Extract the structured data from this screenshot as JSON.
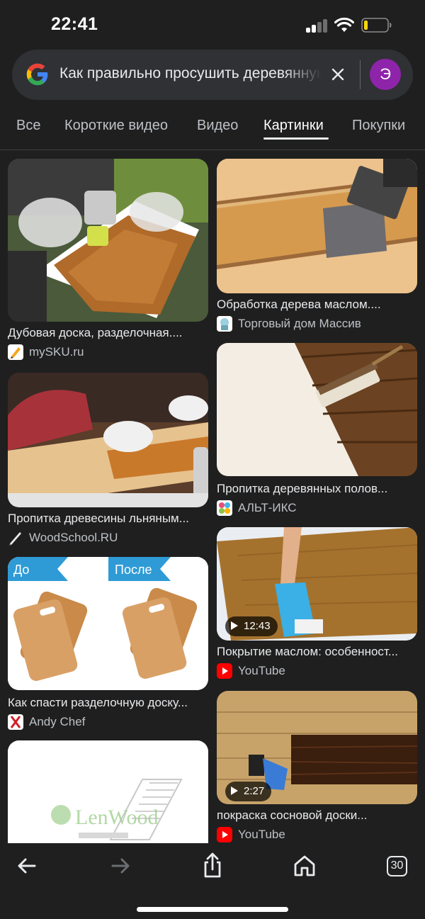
{
  "status": {
    "time": "22:41"
  },
  "search": {
    "query": "Как правильно просушить деревянную доску после пропитки маслом",
    "avatar_letter": "Э"
  },
  "tabs": [
    {
      "label": "Все"
    },
    {
      "label": "Короткие видео"
    },
    {
      "label": "Видео"
    },
    {
      "label": "Картинки",
      "active": true
    },
    {
      "label": "Покупки"
    }
  ],
  "results": [
    {
      "caption": "Дубовая доска, разделочная....",
      "source": "mySKU.ru",
      "icon": "mysku-favicon",
      "image": "gloved-hands-oiling-oak-cutting-board"
    },
    {
      "caption": "Обработка дерева маслом....",
      "source": "Торговый дом Массив",
      "icon": "massiv-favicon",
      "image": "brush-applying-oil-to-pine-board"
    },
    {
      "caption": "Пропитка древесины льняным...",
      "source": "WoodSchool.RU",
      "icon": "woodschool-favicon",
      "image": "hand-wiping-oil-on-pine-plank"
    },
    {
      "caption": "Пропитка деревянных полов...",
      "source": "АЛЬТ-ИКС",
      "icon": "alt-iks-favicon",
      "image": "applicator-staining-dark-floor"
    },
    {
      "caption": "Как спасти разделочную доску...",
      "source": "Andy Chef",
      "icon": "andy-chef-favicon",
      "image": "cutting-boards-before-after",
      "labels": [
        "До",
        "После"
      ]
    },
    {
      "caption": "Покрытие маслом: особенност...",
      "source": "YouTube",
      "icon": "youtube-favicon",
      "image": "blue-glove-oiling-wood-panel",
      "duration": "12:43"
    },
    {
      "caption": "",
      "source": "",
      "icon": "",
      "image": "lenwood-shelf-drawing",
      "watermark": "LenWood"
    },
    {
      "caption": "покраска сосновой доски...",
      "source": "YouTube",
      "icon": "youtube-favicon",
      "image": "brush-painting-dark-stain-pine",
      "duration": "2:27"
    }
  ],
  "bottom_bar": {
    "tab_count": "30"
  },
  "colors": {
    "background": "#1f1f1f",
    "search_bg": "#303134",
    "avatar": "#8e24aa",
    "youtube_red": "#ff0000"
  }
}
